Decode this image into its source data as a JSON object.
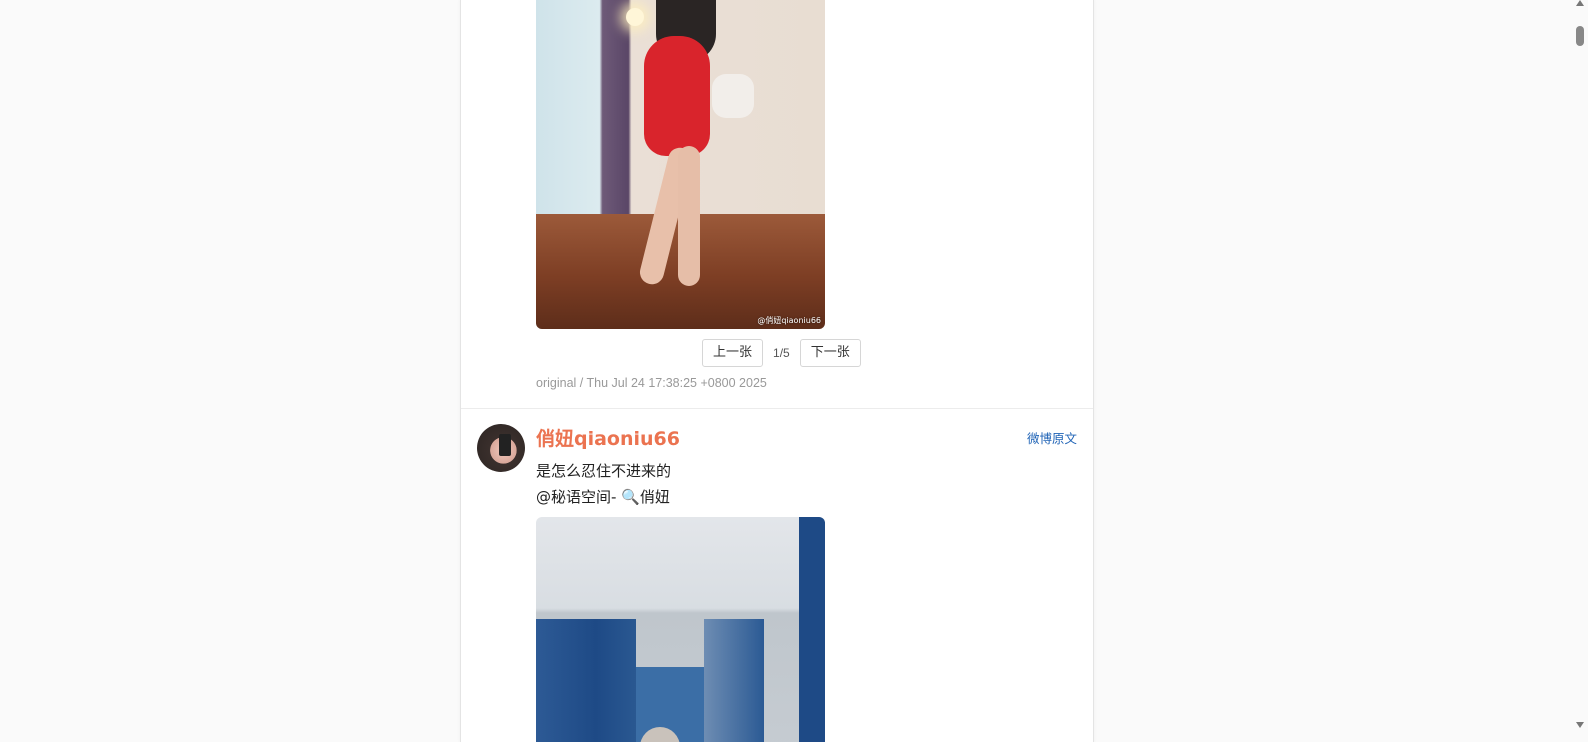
{
  "post1": {
    "watermark": "@俏妞qiaoniu66",
    "pager": {
      "prev_label": "上一张",
      "counter": "1/5",
      "next_label": "下一张"
    },
    "meta": "original / Thu Jul 24 17:38:25 +0800 2025"
  },
  "post2": {
    "username": "俏妞qiaoniu66",
    "original_link": "微博原文",
    "text_line1": "是怎么忍住不进来的",
    "text_line2": "@秘语空间- 🔍俏妞"
  },
  "colors": {
    "username": "#eb7350",
    "link": "#1f63b6",
    "meta": "#999999"
  }
}
